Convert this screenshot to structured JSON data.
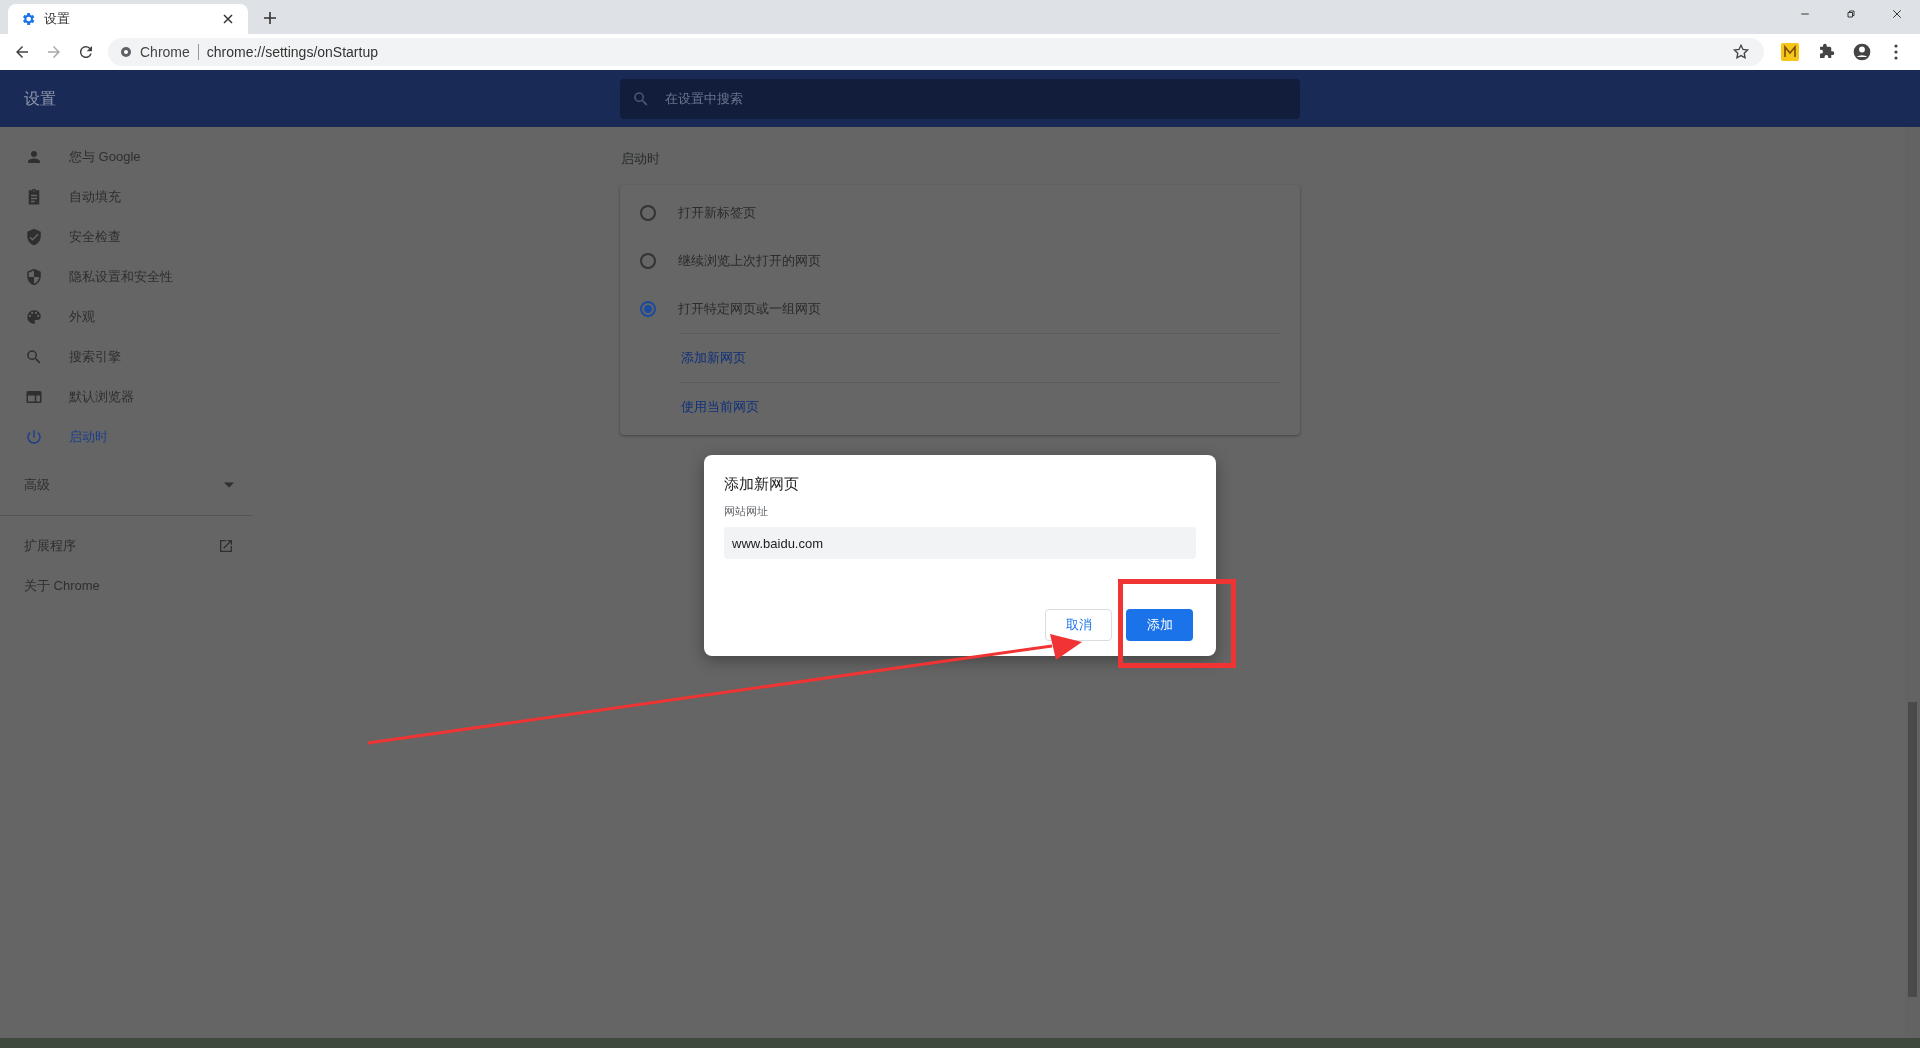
{
  "browser": {
    "tab": {
      "title": "设置",
      "selected": true
    },
    "address": {
      "site_label": "Chrome",
      "url": "chrome://settings/onStartup"
    }
  },
  "header": {
    "title": "设置",
    "search": {
      "placeholder": "在设置中搜索"
    }
  },
  "sidebar": {
    "items": [
      {
        "label": "您与 Google",
        "selected": false
      },
      {
        "label": "自动填充",
        "selected": false
      },
      {
        "label": "安全检查",
        "selected": false
      },
      {
        "label": "隐私设置和安全性",
        "selected": false
      },
      {
        "label": "外观",
        "selected": false
      },
      {
        "label": "搜索引擎",
        "selected": false
      },
      {
        "label": "默认浏览器",
        "selected": false
      },
      {
        "label": "启动时",
        "selected": true
      }
    ],
    "advanced": {
      "label": "高级",
      "expanded": false
    },
    "extensions": "扩展程序",
    "about": "关于 Chrome"
  },
  "section": {
    "title": "启动时",
    "options": [
      {
        "label": "打开新标签页",
        "selected": false
      },
      {
        "label": "继续浏览上次打开的网页",
        "selected": false
      },
      {
        "label": "打开特定网页或一组网页",
        "selected": true
      }
    ],
    "links": [
      "添加新网页",
      "使用当前网页"
    ]
  },
  "dialog": {
    "title": "添加新网页",
    "field_label": "网站网址",
    "field_value": "www.baidu.com",
    "buttons": [
      {
        "label": "取消",
        "kind": "secondary"
      },
      {
        "label": "添加",
        "kind": "primary"
      }
    ]
  }
}
